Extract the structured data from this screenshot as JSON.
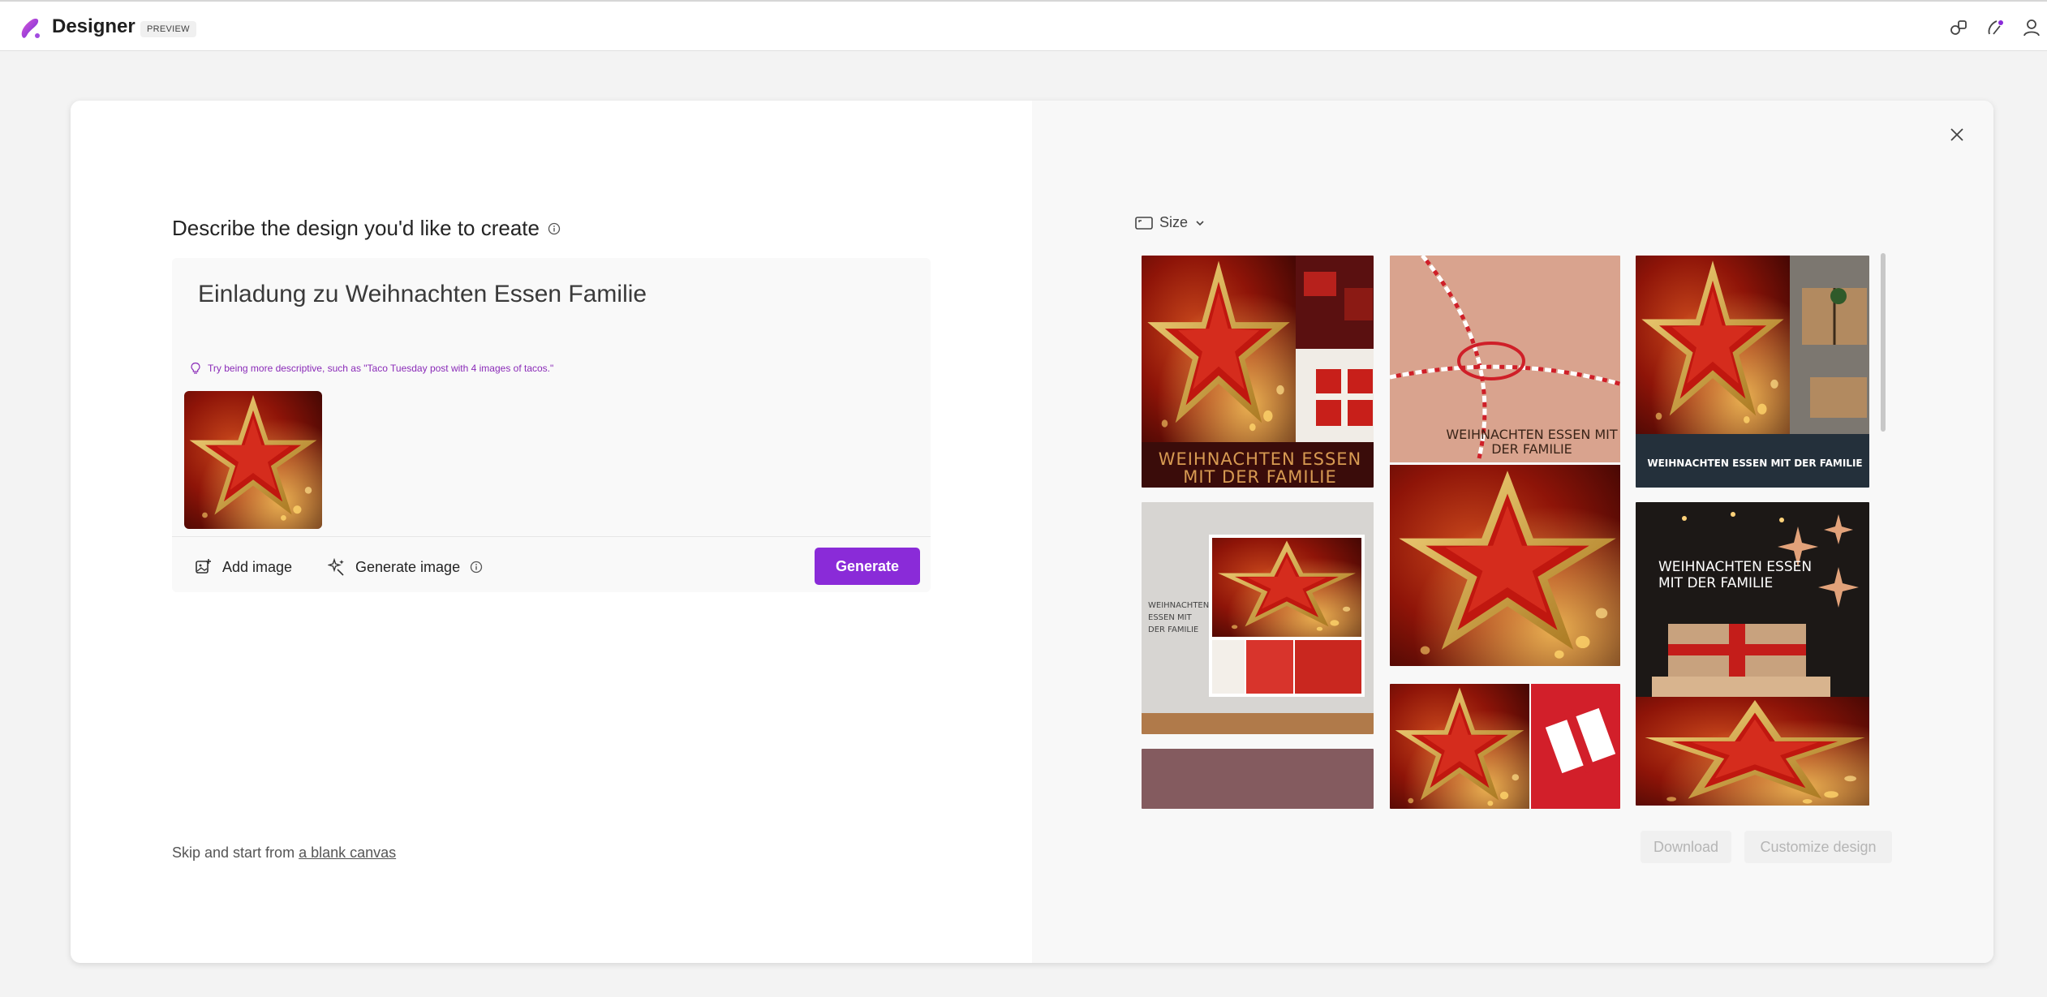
{
  "app": {
    "name": "Designer",
    "badge": "PREVIEW"
  },
  "header_icons": [
    "share-icon",
    "designer-sparkle-icon",
    "profile-icon"
  ],
  "create": {
    "heading": "Describe the design you'd like to create",
    "prompt": "Einladung zu Weihnachten Essen Familie",
    "tip": "Try being more descriptive, such as \"Taco Tuesday post with 4 images of tacos.\"",
    "add_image": "Add image",
    "generate_image": "Generate image",
    "generate": "Generate"
  },
  "skip": {
    "prefix": "Skip and start from ",
    "link": "a blank canvas"
  },
  "results": {
    "size_label": "Size",
    "card_texts": {
      "c1": "WEIHNACHTEN ESSEN MIT DER FAMILIE",
      "c2": "WEIHNACHTEN ESSEN MIT DER FAMILIE",
      "c3": "WEIHNACHTEN ESSEN MIT DER FAMILIE",
      "c4": "WEIHNACHTEN ESSEN MIT DER FAMILIE",
      "c5": "WEIHNACHTEN ESSEN MIT DER FAMILIE"
    },
    "download": "Download",
    "customize": "Customize design"
  },
  "colors": {
    "accent": "#8a2bd8",
    "tip": "#8a2bb8"
  }
}
